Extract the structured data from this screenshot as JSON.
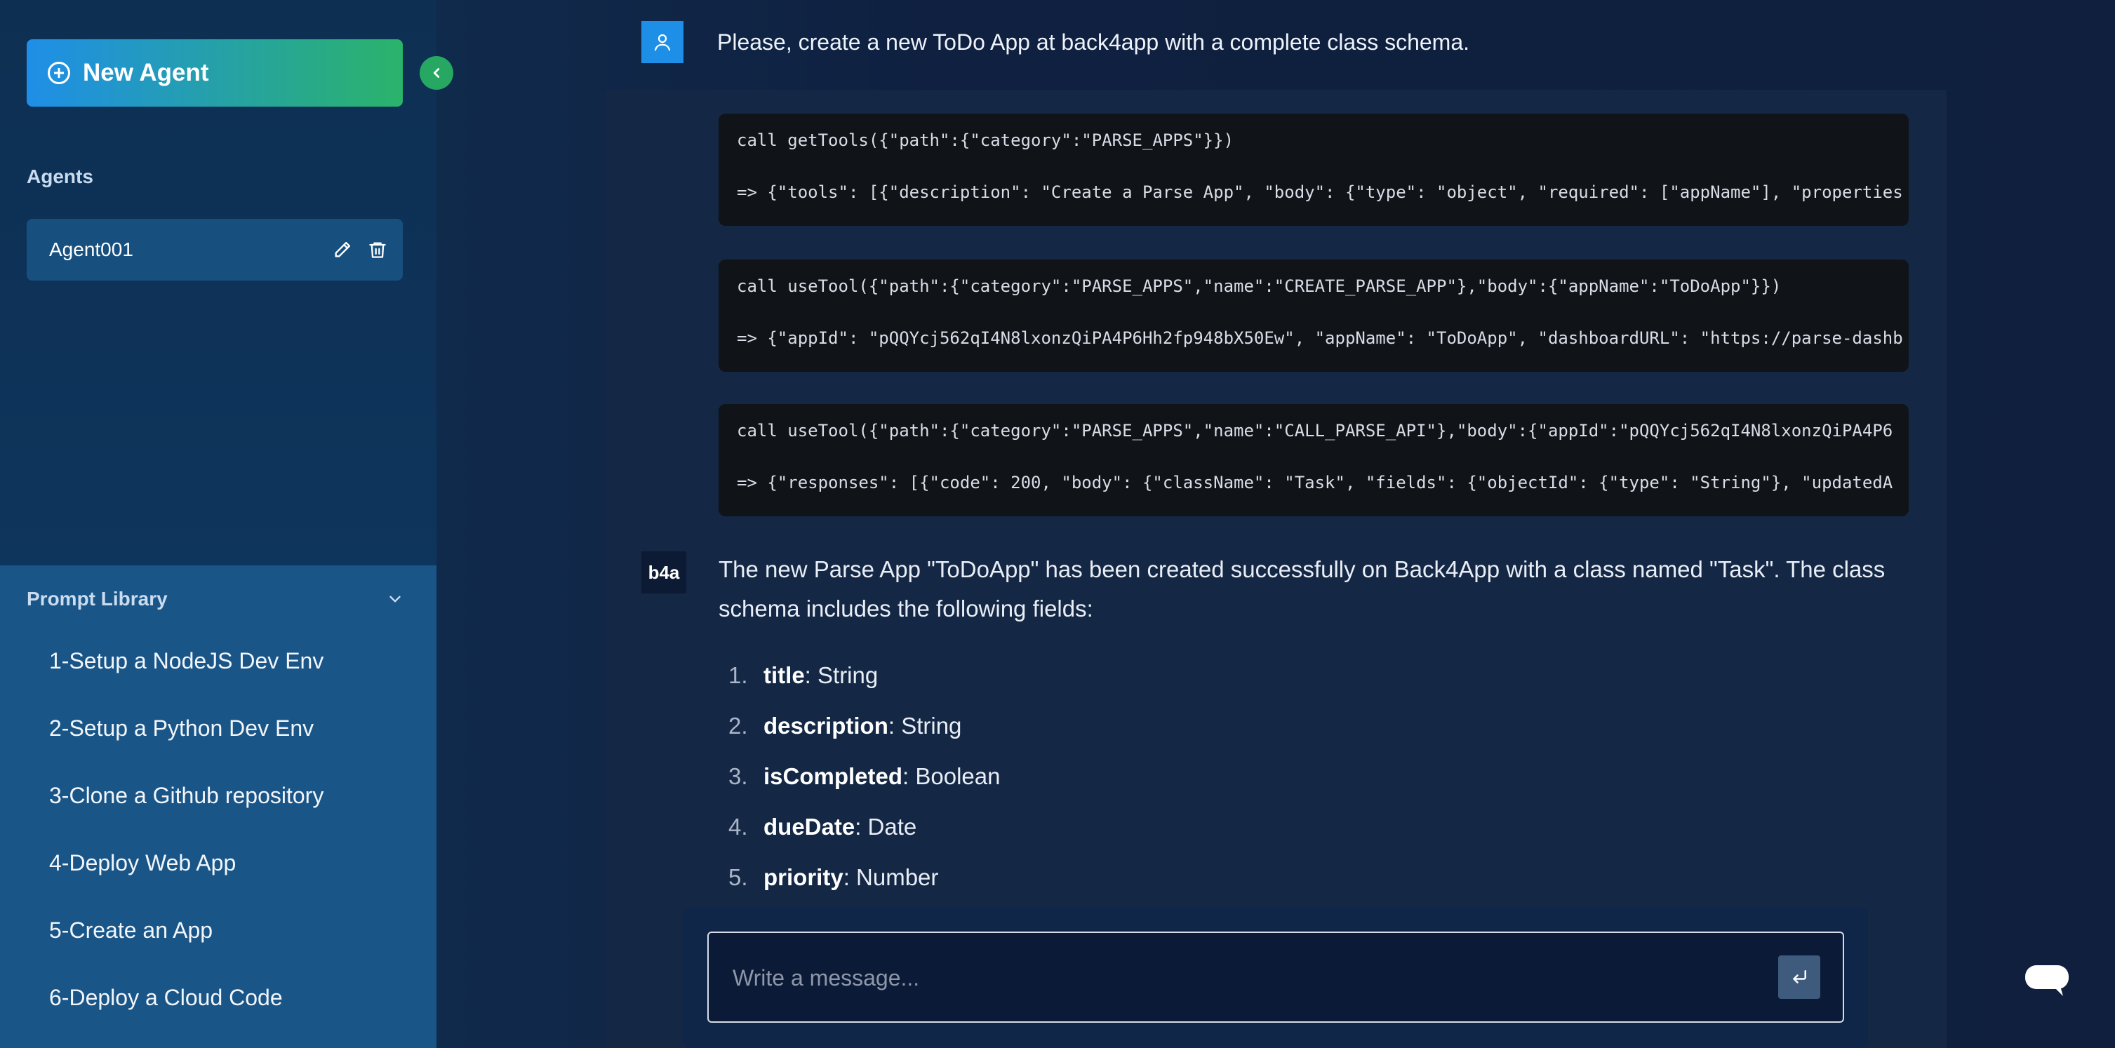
{
  "sidebar": {
    "new_agent_label": "New Agent",
    "agents_title": "Agents",
    "agents": [
      {
        "name": "Agent001"
      }
    ],
    "prompt_library": {
      "title": "Prompt Library",
      "items": [
        "1-Setup a NodeJS Dev Env",
        "2-Setup a Python Dev Env",
        "3-Clone a Github repository",
        "4-Deploy Web App",
        "5-Create an App",
        "6-Deploy a Cloud Code"
      ]
    }
  },
  "chat": {
    "user_message": "Please, create a new ToDo App at back4app with a complete class schema.",
    "tool_calls": [
      {
        "call": "call getTools({\"path\":{\"category\":\"PARSE_APPS\"}})",
        "result": "=> {\"tools\": [{\"description\": \"Create a Parse App\", \"body\": {\"type\": \"object\", \"required\": [\"appName\"], \"properties"
      },
      {
        "call": "call useTool({\"path\":{\"category\":\"PARSE_APPS\",\"name\":\"CREATE_PARSE_APP\"},\"body\":{\"appName\":\"ToDoApp\"}})",
        "result": "=> {\"appId\": \"pQQYcj562qI4N8lxonzQiPA4P6Hh2fp948bX50Ew\", \"appName\": \"ToDoApp\", \"dashboardURL\": \"https://parse-dashb"
      },
      {
        "call": "call useTool({\"path\":{\"category\":\"PARSE_APPS\",\"name\":\"CALL_PARSE_API\"},\"body\":{\"appId\":\"pQQYcj562qI4N8lxonzQiPA4P6",
        "result": "=> {\"responses\": [{\"code\": 200, \"body\": {\"className\": \"Task\", \"fields\": {\"objectId\": {\"type\": \"String\"}, \"updatedA"
      }
    ],
    "assistant_badge": "b4a",
    "assistant_reply": "The new Parse App \"ToDoApp\" has been created successfully on Back4App with a class named \"Task\". The class schema includes the following fields:",
    "fields": [
      {
        "num": "1.",
        "name": "title",
        "type": ": String"
      },
      {
        "num": "2.",
        "name": "description",
        "type": ": String"
      },
      {
        "num": "3.",
        "name": "isCompleted",
        "type": ": Boolean"
      },
      {
        "num": "4.",
        "name": "dueDate",
        "type": ": Date"
      },
      {
        "num": "5.",
        "name": "priority",
        "type": ": Number"
      }
    ]
  },
  "composer": {
    "placeholder": "Write a message..."
  },
  "colors": {
    "sidebar_bg": "#0d2f52",
    "prompt_library_bg": "#1a5588",
    "accent_blue": "#1f8ee8",
    "accent_green": "#2bb36a",
    "main_bg": "#0f1f3d"
  },
  "icons": [
    "plus-circle-icon",
    "chevron-left-icon",
    "pencil-icon",
    "trash-icon",
    "chevron-down-icon",
    "user-icon",
    "enter-icon",
    "chat-bubble-icon"
  ]
}
